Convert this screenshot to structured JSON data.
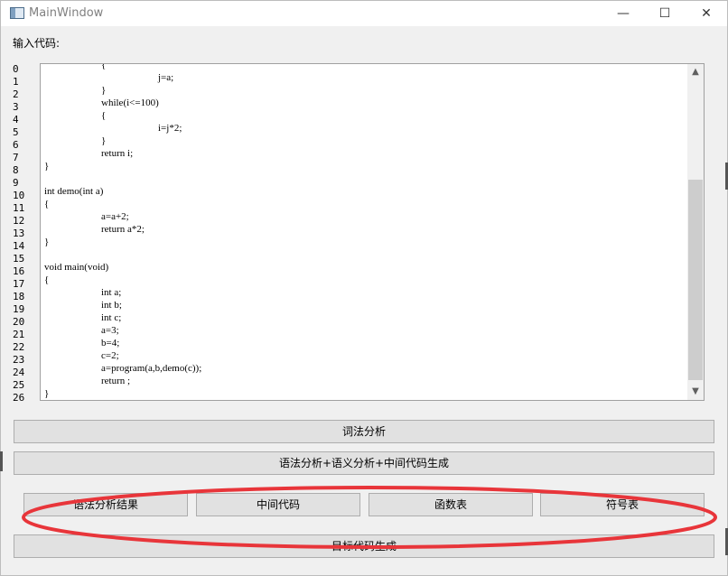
{
  "window": {
    "title": "MainWindow",
    "minimize_glyph": "—",
    "maximize_glyph": "☐",
    "close_glyph": "✕"
  },
  "input_label": "输入代码:",
  "editor": {
    "line_numbers": [
      "0",
      "1",
      "2",
      "3",
      "4",
      "5",
      "6",
      "7",
      "8",
      "9",
      "10",
      "11",
      "12",
      "13",
      "14",
      "15",
      "16",
      "17",
      "18",
      "19",
      "20",
      "21",
      "22",
      "23",
      "24",
      "25",
      "26"
    ],
    "lines": [
      {
        "text": "{",
        "indent": 1
      },
      {
        "text": "j=a;",
        "indent": 2
      },
      {
        "text": "}",
        "indent": 1
      },
      {
        "text": "while(i<=100)",
        "indent": 1
      },
      {
        "text": "{",
        "indent": 1
      },
      {
        "text": "i=j*2;",
        "indent": 2
      },
      {
        "text": "}",
        "indent": 1
      },
      {
        "text": "return i;",
        "indent": 1
      },
      {
        "text": "}",
        "indent": 0
      },
      {
        "text": "",
        "indent": 0
      },
      {
        "text": "int demo(int a)",
        "indent": 0
      },
      {
        "text": "{",
        "indent": 0
      },
      {
        "text": "a=a+2;",
        "indent": 1
      },
      {
        "text": "return a*2;",
        "indent": 1
      },
      {
        "text": "}",
        "indent": 0
      },
      {
        "text": "",
        "indent": 0
      },
      {
        "text": "void main(void)",
        "indent": 0
      },
      {
        "text": "{",
        "indent": 0
      },
      {
        "text": "int a;",
        "indent": 1
      },
      {
        "text": "int b;",
        "indent": 1
      },
      {
        "text": "int c;",
        "indent": 1
      },
      {
        "text": "a=3;",
        "indent": 1
      },
      {
        "text": "b=4;",
        "indent": 1
      },
      {
        "text": "c=2;",
        "indent": 1
      },
      {
        "text": "a=program(a,b,demo(c));",
        "indent": 1
      },
      {
        "text": "return ;",
        "indent": 1
      },
      {
        "text": "}",
        "indent": 0
      }
    ],
    "scroll_up": "▲",
    "scroll_down": "▼"
  },
  "buttons": {
    "lexical": "词法分析",
    "syntax": "语法分析+语义分析+中间代码生成",
    "syntax_result": "语法分析结果",
    "intermediate": "中间代码",
    "function_table": "函数表",
    "symbol_table": "符号表",
    "target_code": "目标代码生成"
  },
  "annotation": {
    "color": "#e8353a"
  }
}
